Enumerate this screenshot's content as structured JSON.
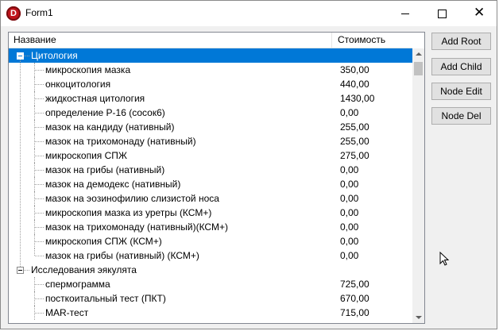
{
  "window": {
    "title": "Form1",
    "icon": "delphi-app-icon"
  },
  "tree": {
    "columns": [
      "Название",
      "Стоимость"
    ],
    "groups": [
      {
        "label": "Цитология",
        "selected": true,
        "items": [
          {
            "name": "микроскопия мазка",
            "cost": "350,00"
          },
          {
            "name": "онкоцитология",
            "cost": "440,00"
          },
          {
            "name": "жидкостная цитология",
            "cost": "1430,00"
          },
          {
            "name": "определение Р-16 (сосок6)",
            "cost": "0,00"
          },
          {
            "name": "мазок на кандиду (нативный)",
            "cost": "255,00"
          },
          {
            "name": "мазок на трихомонаду (нативный)",
            "cost": "255,00"
          },
          {
            "name": "микроскопия СПЖ",
            "cost": "275,00"
          },
          {
            "name": "мазок на грибы (нативный)",
            "cost": "0,00"
          },
          {
            "name": "мазок на демодекс (нативный)",
            "cost": "0,00"
          },
          {
            "name": "мазок на эозинофилию слизистой носа",
            "cost": "0,00"
          },
          {
            "name": "микроскопия мазка из уретры (КСМ+)",
            "cost": "0,00"
          },
          {
            "name": "мазок на трихомонаду (нативный)(КСМ+)",
            "cost": "0,00"
          },
          {
            "name": "микроскопия СПЖ (КСМ+)",
            "cost": "0,00"
          },
          {
            "name": "мазок на грибы (нативный) (КСМ+)",
            "cost": "0,00"
          }
        ]
      },
      {
        "label": "Исследования эякулята",
        "selected": false,
        "items": [
          {
            "name": "спермограмма",
            "cost": "725,00"
          },
          {
            "name": "посткоитальный тест (ПКТ)",
            "cost": "670,00"
          },
          {
            "name": "MAR-тест",
            "cost": "715,00"
          }
        ]
      }
    ]
  },
  "buttons": {
    "add_root": "Add Root",
    "add_child": "Add Child",
    "node_edit": "Node Edit",
    "node_del": "Node Del"
  },
  "colors": {
    "selection": "#0078d7",
    "window_bg": "#f0f0f0"
  }
}
